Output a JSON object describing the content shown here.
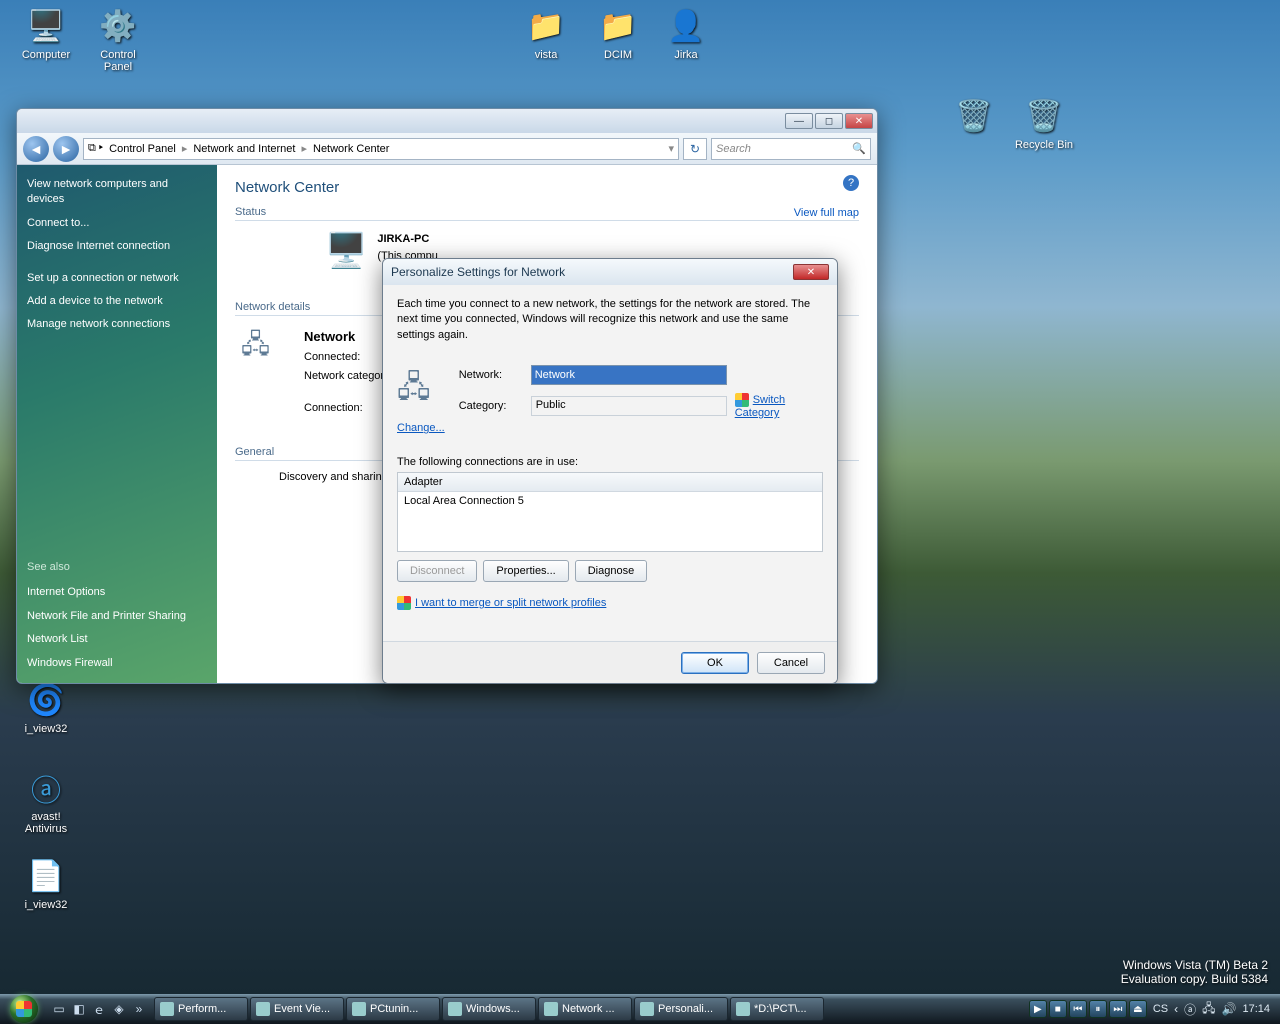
{
  "desktop": {
    "icons": {
      "computer": "Computer",
      "control_panel": "Control\nPanel",
      "vista": "vista",
      "dcim": "DCIM",
      "jirka": "Jirka",
      "recycle_bin": "Recycle Bin",
      "iview32a": "i_view32",
      "avast": "avast!\nAntivirus",
      "iview32b": "i_view32"
    },
    "watermark_line1": "Windows Vista (TM) Beta 2",
    "watermark_line2": "Evaluation copy. Build 5384"
  },
  "window": {
    "breadcrumb": {
      "p1": "Control Panel",
      "p2": "Network and Internet",
      "p3": "Network Center"
    },
    "search_placeholder": "Search",
    "title": "Network Center",
    "sidebar": {
      "s1": "View network computers and devices",
      "s2": "Connect to...",
      "s3": "Diagnose Internet connection",
      "s4": "Set up a connection or network",
      "s5": "Add a device to the network",
      "s6": "Manage network connections",
      "see_also": "See also",
      "sa1": "Internet Options",
      "sa2": "Network File and Printer Sharing",
      "sa3": "Network List",
      "sa4": "Windows Firewall"
    },
    "status_label": "Status",
    "view_full_map": "View full map",
    "computer_name": "JIRKA-PC",
    "computer_sub": "(This compu",
    "details_label": "Network details",
    "network_name": "Network",
    "connected_label": "Connected:",
    "category_label": "Network category:",
    "connection_label": "Connection:",
    "general_label": "General",
    "discovery_label": "Discovery and sharing:"
  },
  "dialog": {
    "title": "Personalize Settings for Network",
    "intro": "Each time you connect to a new network, the settings for the network are stored. The next time you connected, Windows will recognize this network and use the same settings again.",
    "change": "Change...",
    "network_label": "Network:",
    "network_value": "Network",
    "category_label": "Category:",
    "category_value": "Public",
    "switch_category": "Switch Category",
    "conns_label": "The following connections are in use:",
    "adapter_header": "Adapter",
    "adapter_row": "Local Area Connection 5",
    "btn_disconnect": "Disconnect",
    "btn_properties": "Properties...",
    "btn_diagnose": "Diagnose",
    "merge_link": "I want to merge or split network profiles",
    "ok": "OK",
    "cancel": "Cancel"
  },
  "taskbar": {
    "tasks": {
      "t1": "Perform...",
      "t2": "Event Vie...",
      "t3": "PCtunin...",
      "t4": "Windows...",
      "t5": "Network ...",
      "t6": "Personali...",
      "t7": "*D:\\PCT\\..."
    },
    "lang": "CS",
    "clock": "17:14"
  }
}
